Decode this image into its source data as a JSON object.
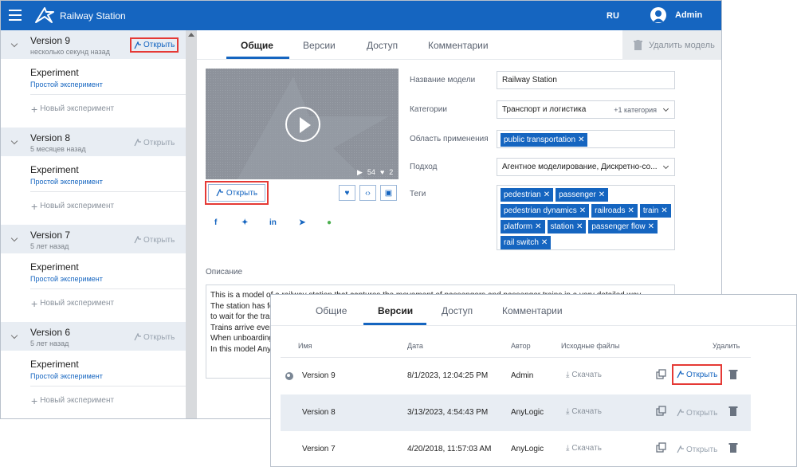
{
  "header": {
    "app_title": "Railway Station",
    "language": "RU",
    "user": "Admin"
  },
  "sidebar": {
    "versions": [
      {
        "title": "Version 9",
        "subtitle": "несколько секунд назад",
        "open_label": "Открыть",
        "experiment": "Experiment",
        "experiment_type": "Простой эксперимент",
        "new_experiment": "Новый эксперимент"
      },
      {
        "title": "Version 8",
        "subtitle": "5 месяцев назад",
        "open_label": "Открыть",
        "experiment": "Experiment",
        "experiment_type": "Простой эксперимент",
        "new_experiment": "Новый эксперимент"
      },
      {
        "title": "Version 7",
        "subtitle": "5 лет назад",
        "open_label": "Открыть",
        "experiment": "Experiment",
        "experiment_type": "Простой эксперимент",
        "new_experiment": "Новый эксперимент"
      },
      {
        "title": "Version 6",
        "subtitle": "5 лет назад",
        "open_label": "Открыть",
        "experiment": "Experiment",
        "experiment_type": "Простой эксперимент",
        "new_experiment": "Новый эксперимент"
      }
    ]
  },
  "main": {
    "tabs": [
      "Общие",
      "Версии",
      "Доступ",
      "Комментарии"
    ],
    "delete_model": "Удалить модель",
    "video": {
      "views": "54",
      "likes": "2"
    },
    "open_button": "Открыть",
    "fields": {
      "name_label": "Название модели",
      "name_value": "Railway Station",
      "categories_label": "Категории",
      "categories_value": "Транспорт и логистика",
      "categories_more": "+1 категория",
      "area_label": "Область применения",
      "area_chip": "public transportation",
      "approach_label": "Подход",
      "approach_value": "Агентное моделирование, Дискретно-со...",
      "tags_label": "Теги",
      "tags": [
        "pedestrian",
        "passenger",
        "pedestrian dynamics",
        "railroads",
        "train",
        "platform",
        "station",
        "passenger flow",
        "rail switch"
      ]
    },
    "description_label": "Описание",
    "description_lines": [
      "This is a model of a railway station that captures the movement of passengers and passenger trains in a very detailed way.",
      "The station has fo",
      "to wait for the tra",
      "Trains arrive every",
      "When unboarding",
      "In this model Any"
    ]
  },
  "overlay": {
    "tabs": [
      "Общие",
      "Версии",
      "Доступ",
      "Комментарии"
    ],
    "columns": {
      "name": "Имя",
      "date": "Дата",
      "author": "Автор",
      "source": "Исходные файлы",
      "delete": "Удалить"
    },
    "download_label": "Скачать",
    "open_label": "Открыть",
    "rows": [
      {
        "name": "Version 9",
        "date": "8/1/2023, 12:04:25 PM",
        "author": "Admin"
      },
      {
        "name": "Version 8",
        "date": "3/13/2023, 4:54:43 PM",
        "author": "AnyLogic"
      },
      {
        "name": "Version 7",
        "date": "4/20/2018, 11:57:03 AM",
        "author": "AnyLogic"
      }
    ]
  },
  "colors": {
    "primary": "#1565c0",
    "highlight": "#e53935",
    "row_alt": "#e8edf3"
  }
}
